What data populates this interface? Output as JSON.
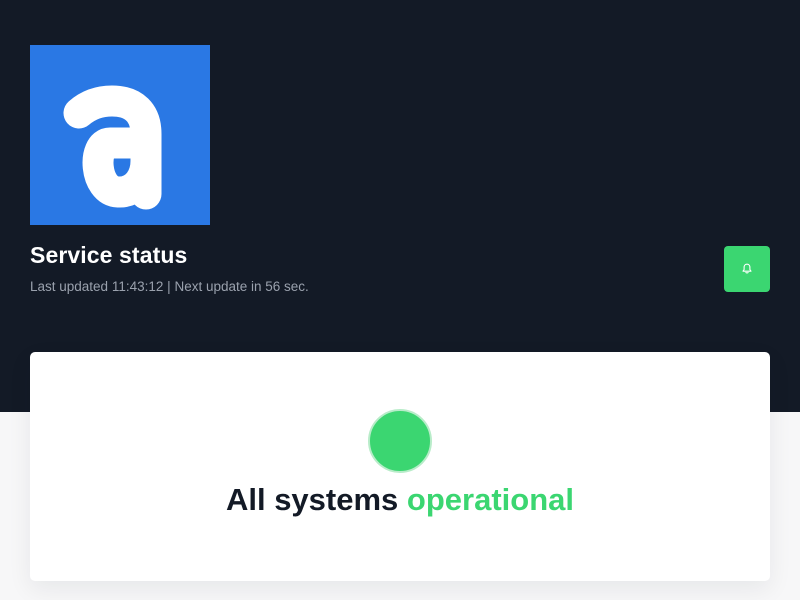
{
  "header": {
    "logo_icon": "brand-a-logo-icon",
    "title": "Service status",
    "last_updated_label": "Last updated",
    "last_updated_time": "11:43:12",
    "separator": "|",
    "next_update_label": "Next update in",
    "next_update_value": "56 sec.",
    "subscribe_button_icon": "bell-icon"
  },
  "status": {
    "indicator_icon": "status-circle-icon",
    "prefix": "All systems",
    "state": "operational"
  },
  "colors": {
    "background_dark": "#131a26",
    "brand_blue": "#2a78e4",
    "operational_green": "#3bd671",
    "muted_text": "#9aa1ad",
    "page_light": "#f7f7f8"
  }
}
